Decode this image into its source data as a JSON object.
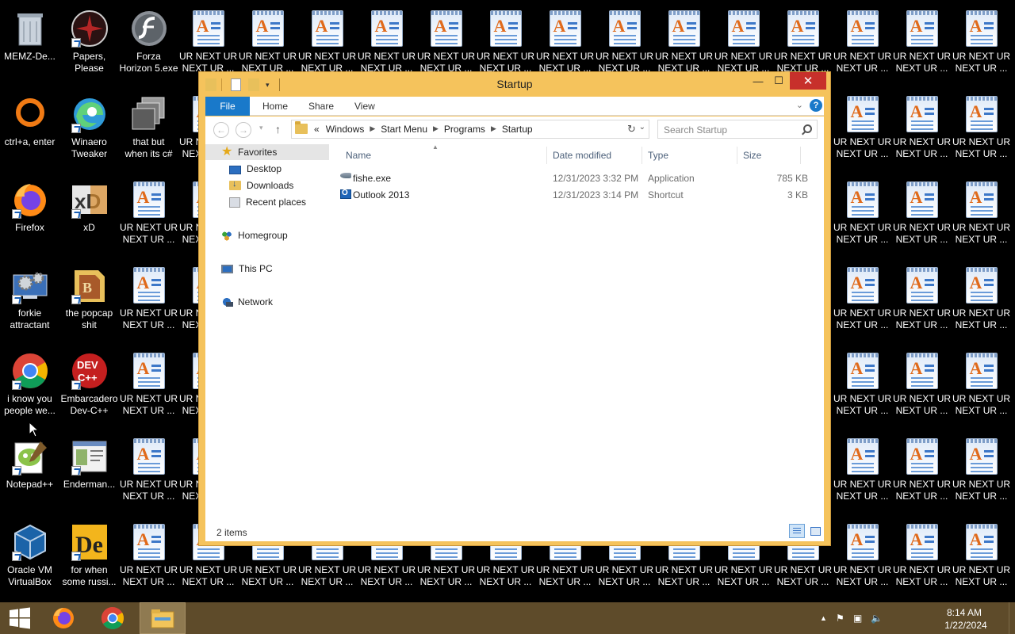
{
  "desktop": {
    "icons": [
      {
        "label": "MEMZ-De...",
        "type": "recycle"
      },
      {
        "label": "Papers,\nPlease",
        "type": "papers"
      },
      {
        "label": "Forza\nHorizon 5.exe",
        "type": "flash"
      },
      {
        "label": "ctrl+a, enter",
        "type": "ring"
      },
      {
        "label": "Winaero\nTweaker",
        "type": "edge"
      },
      {
        "label": "that but\nwhen its c#",
        "type": "stack"
      },
      {
        "label": "Firefox",
        "type": "firefox"
      },
      {
        "label": "xD",
        "type": "xd"
      },
      {
        "label": "forkie\nattractant",
        "type": "gear"
      },
      {
        "label": "the popcap\nshit",
        "type": "folder-doc"
      },
      {
        "label": "i know you\npeople we...",
        "type": "chrome"
      },
      {
        "label": "Embarcadero\nDev-C++",
        "type": "devcpp"
      },
      {
        "label": "Notepad++",
        "type": "notepadpp"
      },
      {
        "label": "Enderman...",
        "type": "window-img"
      },
      {
        "label": "Oracle VM\nVirtualBox",
        "type": "virtualbox"
      },
      {
        "label": "for when\nsome russi...",
        "type": "de"
      }
    ],
    "wordpad_label": "UR NEXT UR\nNEXT UR ..."
  },
  "window": {
    "title": "Startup",
    "controls": {
      "minimize": "—",
      "maximize": "☐",
      "close": "✕"
    },
    "ribbon_tabs": {
      "file": "File",
      "home": "Home",
      "share": "Share",
      "view": "View"
    },
    "help": "?",
    "address": {
      "prefix": "«",
      "crumbs": [
        "Windows",
        "Start Menu",
        "Programs",
        "Startup"
      ]
    },
    "search_placeholder": "Search Startup",
    "nav": {
      "favorites": "Favorites",
      "desktop": "Desktop",
      "downloads": "Downloads",
      "recent": "Recent places",
      "homegroup": "Homegroup",
      "thispc": "This PC",
      "network": "Network"
    },
    "columns": {
      "name": "Name",
      "date": "Date modified",
      "type": "Type",
      "size": "Size"
    },
    "files": [
      {
        "name": "fishe.exe",
        "date": "12/31/2023 3:32 PM",
        "type": "Application",
        "size": "785 KB",
        "icon": "fish-icon"
      },
      {
        "name": "Outlook 2013",
        "date": "12/31/2023 3:14 PM",
        "type": "Shortcut",
        "size": "3 KB",
        "icon": "outlook-icon"
      }
    ],
    "status": "2 items"
  },
  "taskbar": {
    "time": "8:14 AM",
    "date": "1/22/2024",
    "pinned": [
      "windows-start-icon",
      "firefox-icon",
      "chrome-icon",
      "file-explorer-icon"
    ]
  },
  "colors": {
    "window_frame": "#f5c35c",
    "file_tab": "#1979ca",
    "close_button": "#c7302b",
    "taskbar": "#5e4b2a"
  }
}
